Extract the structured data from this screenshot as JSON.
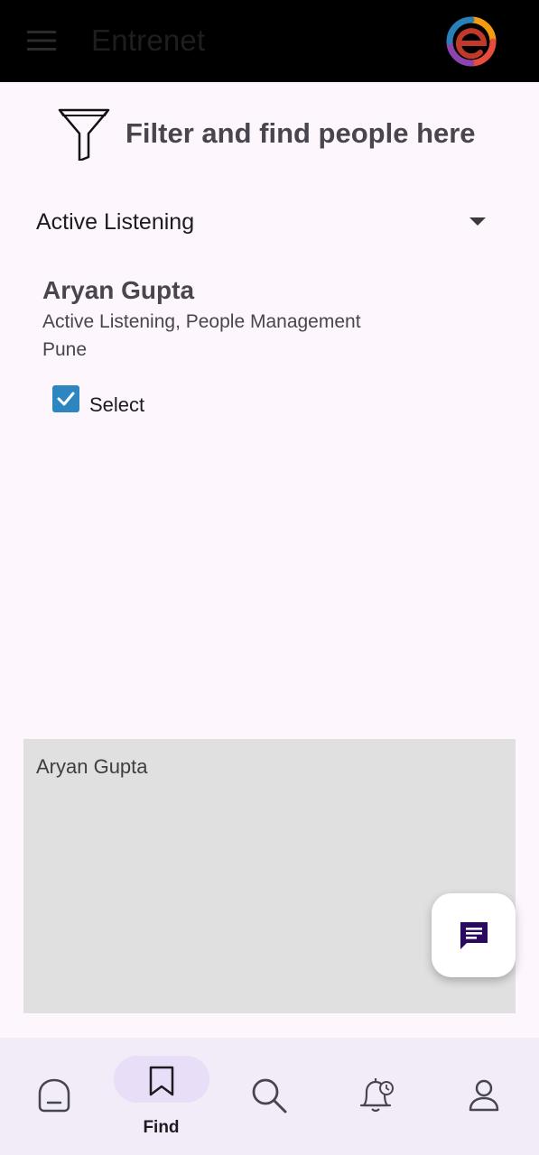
{
  "appbar": {
    "title": "Entrenet",
    "menu_icon": "hamburger-menu-icon",
    "logo_icon": "entrenet-logo-icon"
  },
  "filter": {
    "title": "Filter and find people here",
    "icon": "funnel-icon"
  },
  "dropdown": {
    "selected_value": "Active Listening"
  },
  "results": [
    {
      "name": "Aryan Gupta",
      "skills": "Active Listening, People Management",
      "city": "Pune",
      "select_label": "Select",
      "checked": true
    }
  ],
  "selected_panel": {
    "names": [
      "Aryan Gupta"
    ]
  },
  "fab": {
    "icon": "chat-message-icon"
  },
  "bottom_nav": {
    "active": "find",
    "items": [
      {
        "id": "home",
        "icon": "home-icon",
        "label": ""
      },
      {
        "id": "find",
        "icon": "bookmark-icon",
        "label": "Find"
      },
      {
        "id": "search",
        "icon": "search-icon",
        "label": ""
      },
      {
        "id": "notifications",
        "icon": "bell-clock-icon",
        "label": ""
      },
      {
        "id": "profile",
        "icon": "person-icon",
        "label": ""
      }
    ]
  },
  "colors": {
    "appbar_bg": "#000000",
    "background": "#fdf6fd",
    "checkbox": "#2e86c1",
    "fab_icon": "#2a0a5e",
    "nav_bg": "#f1ecf7",
    "nav_active_pill": "#e8def8",
    "panel_bg": "#e0e0e0"
  }
}
